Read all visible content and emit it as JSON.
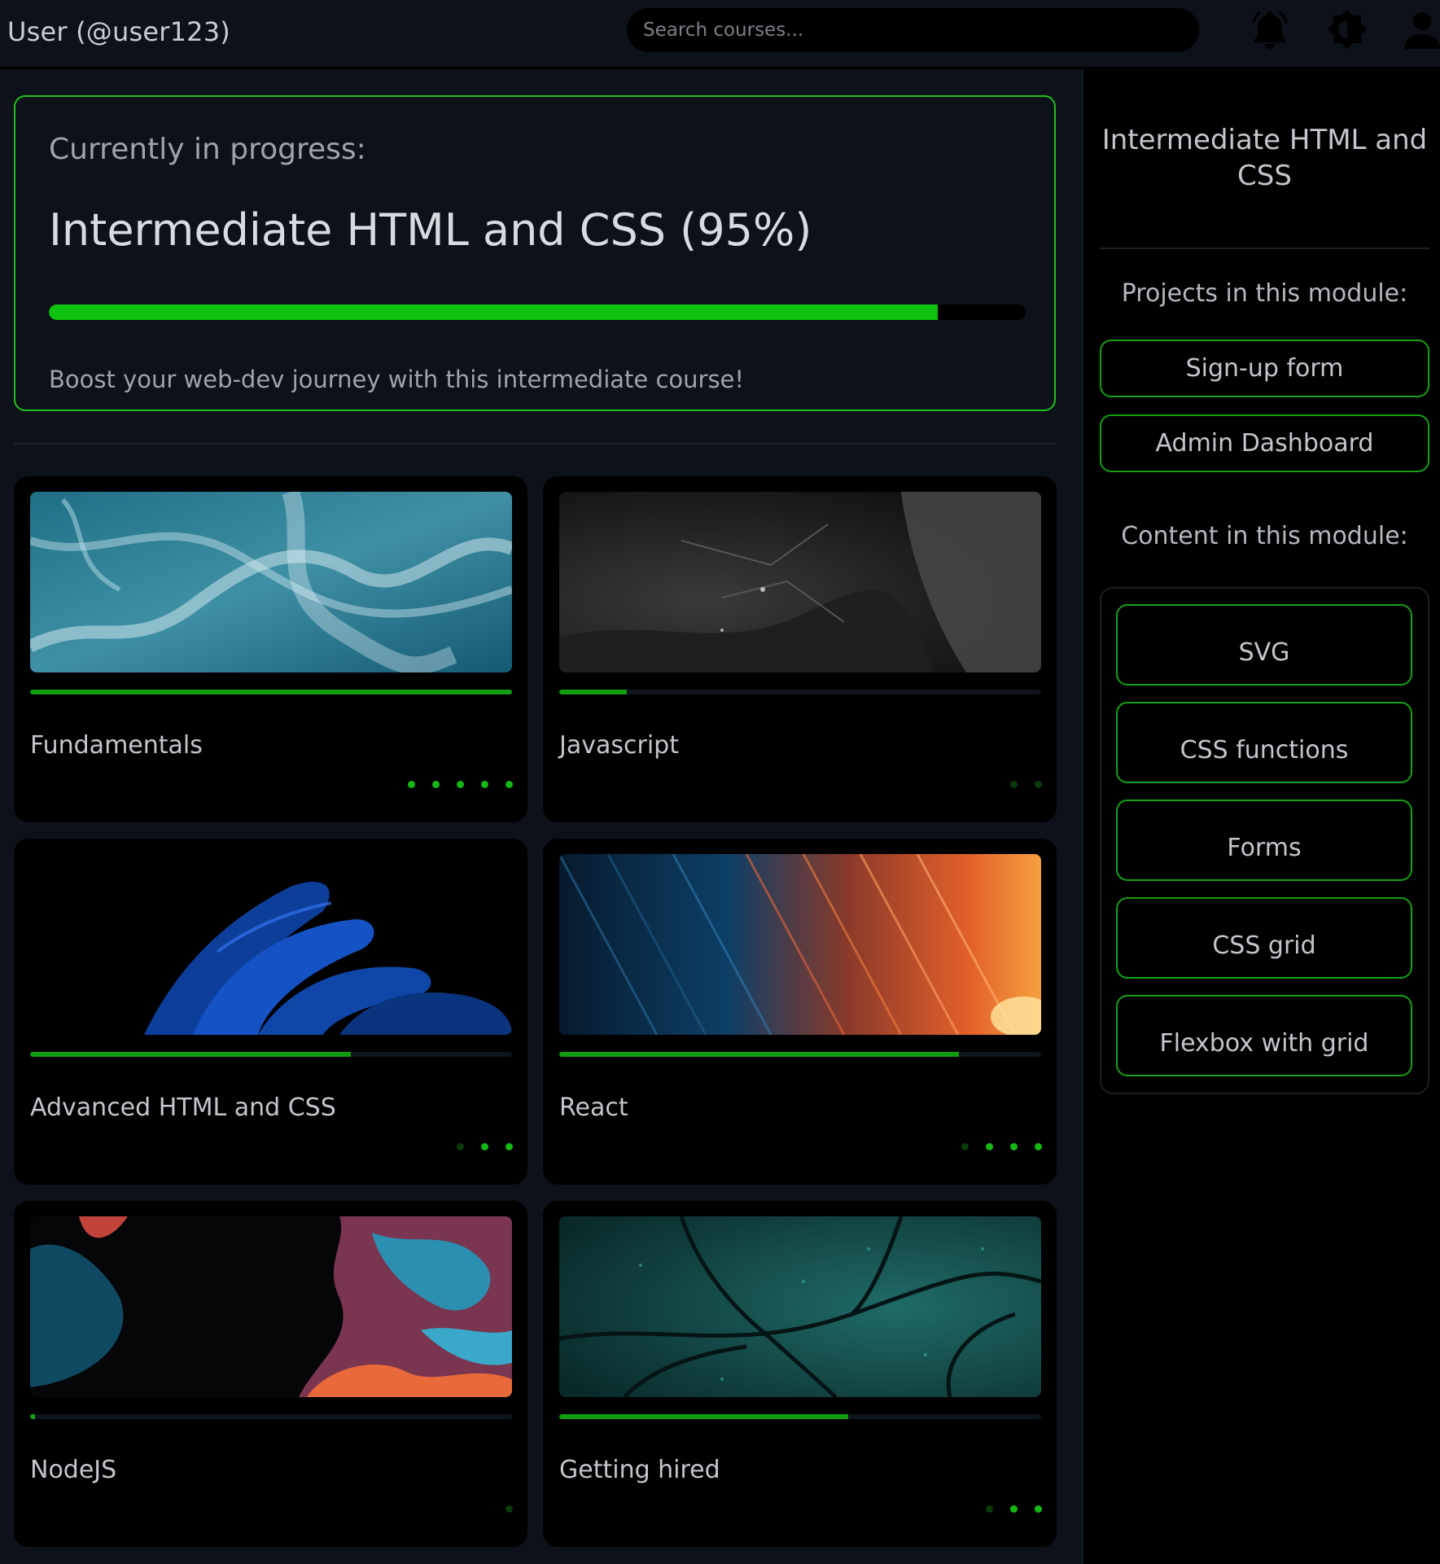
{
  "header": {
    "user_label": "User (@user123)",
    "search_placeholder": "Search courses...",
    "icons": [
      "bell-icon",
      "brightness-icon",
      "user-icon"
    ]
  },
  "progress": {
    "heading": "Currently in progress:",
    "course": "Intermediate HTML and CSS (95%)",
    "percent": 0.91,
    "description": "Boost your web-dev journey with this intermediate course!",
    "accent": "#0fc20f"
  },
  "courses": [
    {
      "title": "Fundamentals",
      "progress": 1.0,
      "image": "ocean-waves",
      "dots_total": 5,
      "dots_done": 5
    },
    {
      "title": "Javascript",
      "progress": 0.14,
      "image": "dark-rock",
      "dots_total": 2,
      "dots_done": 0
    },
    {
      "title": "Advanced HTML and CSS",
      "progress": 0.665,
      "image": "blue-feathers",
      "dots_total": 3,
      "dots_done": 2
    },
    {
      "title": "React",
      "progress": 0.83,
      "image": "light-streaks",
      "dots_total": 4,
      "dots_done": 3
    },
    {
      "title": "NodeJS",
      "progress": 0.01,
      "image": "fluid-paint",
      "dots_total": 1,
      "dots_done": 0
    },
    {
      "title": "Getting hired",
      "progress": 0.6,
      "image": "teal-leaf",
      "dots_total": 3,
      "dots_done": 2
    }
  ],
  "sidebar": {
    "title": "Intermediate HTML and CSS",
    "projects_heading": "Projects in this module:",
    "projects": [
      "Sign-up form",
      "Admin Dashboard"
    ],
    "content_heading": "Content in this module:",
    "content": [
      "SVG",
      "CSS functions",
      "Forms",
      "CSS grid",
      "Flexbox with grid"
    ]
  },
  "colors": {
    "background": "#0c111a",
    "card": "#000000",
    "accent_green": "#0fc20f",
    "border_green": "#15a015",
    "dot_done": "#15b815",
    "dot_pending": "#0b3a0b"
  }
}
